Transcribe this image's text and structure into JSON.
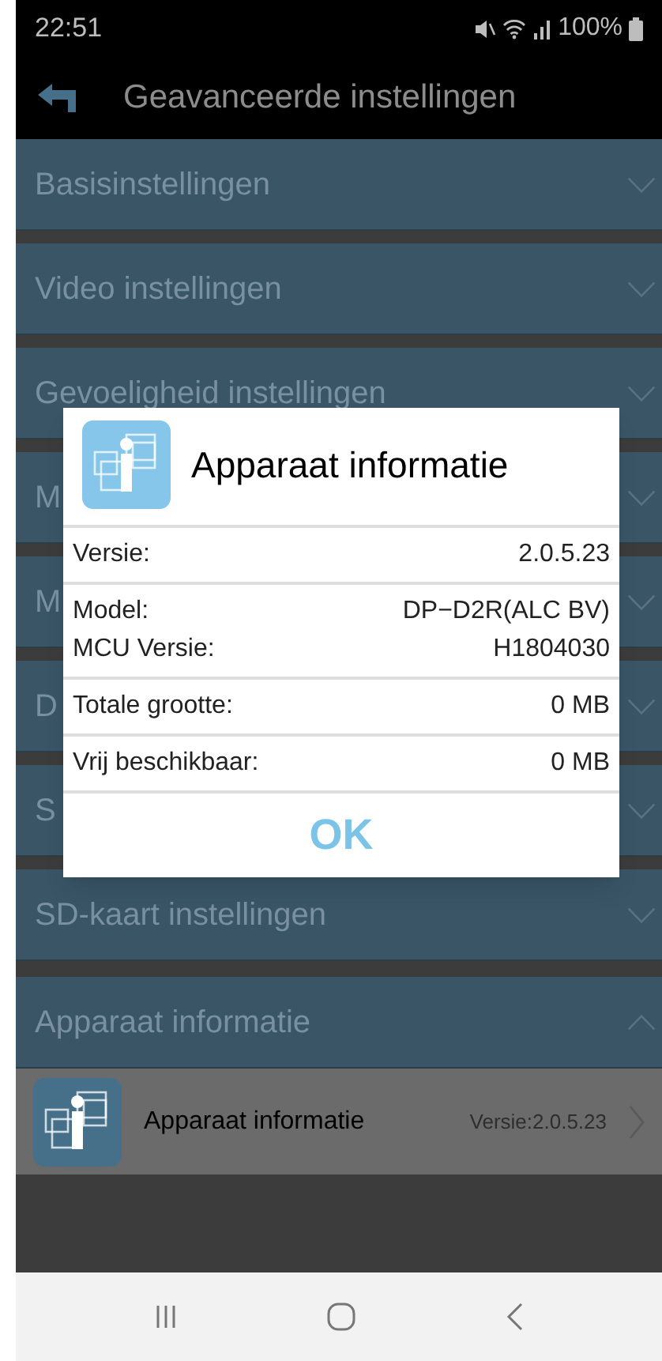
{
  "status_bar": {
    "time": "22:51",
    "battery": "100%"
  },
  "toolbar": {
    "title": "Geavanceerde instellingen"
  },
  "sections": [
    {
      "label": "Basisinstellingen",
      "expanded": false
    },
    {
      "label": "Video instellingen",
      "expanded": false
    },
    {
      "label": "Gevoeligheid instellingen",
      "expanded": false
    },
    {
      "label": "M",
      "expanded": false
    },
    {
      "label": "M",
      "expanded": false
    },
    {
      "label": "D",
      "expanded": false
    },
    {
      "label": "S",
      "expanded": false
    },
    {
      "label": "SD-kaart instellingen",
      "expanded": false
    },
    {
      "label": "Apparaat informatie",
      "expanded": true,
      "items": [
        {
          "title": "Apparaat informatie",
          "value": "Versie:2.0.5.23"
        }
      ]
    }
  ],
  "dialog": {
    "title": "Apparaat informatie",
    "groups": [
      [
        {
          "label": "Versie:",
          "value": "2.0.5.23"
        }
      ],
      [
        {
          "label": "Model:",
          "value": "DP−D2R(ALC BV)"
        },
        {
          "label": "MCU Versie:",
          "value": "H1804030"
        }
      ],
      [
        {
          "label": "Totale grootte:",
          "value": "0 MB"
        }
      ],
      [
        {
          "label": "Vrij beschikbaar:",
          "value": "0 MB"
        }
      ]
    ],
    "button": "OK"
  }
}
